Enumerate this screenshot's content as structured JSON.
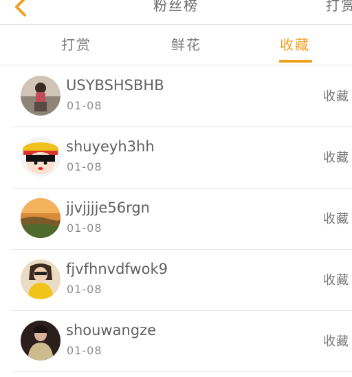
{
  "header": {
    "title": "粉丝榜",
    "right_label": "打赏"
  },
  "tabs": [
    {
      "label": "打赏",
      "active": false
    },
    {
      "label": "鲜花",
      "active": false
    },
    {
      "label": "收藏",
      "active": true
    }
  ],
  "accent_color": "#f0a020",
  "users": [
    {
      "name": "USYBSHSBHB",
      "date": "01-08",
      "action": "收藏"
    },
    {
      "name": "shuyeyh3hh",
      "date": "01-08",
      "action": "收藏"
    },
    {
      "name": "jjvjjjje56rgn",
      "date": "01-08",
      "action": "收藏"
    },
    {
      "name": "fjvfhnvdfwok9",
      "date": "01-08",
      "action": "收藏"
    },
    {
      "name": "shouwangze",
      "date": "01-08",
      "action": "收藏"
    }
  ]
}
